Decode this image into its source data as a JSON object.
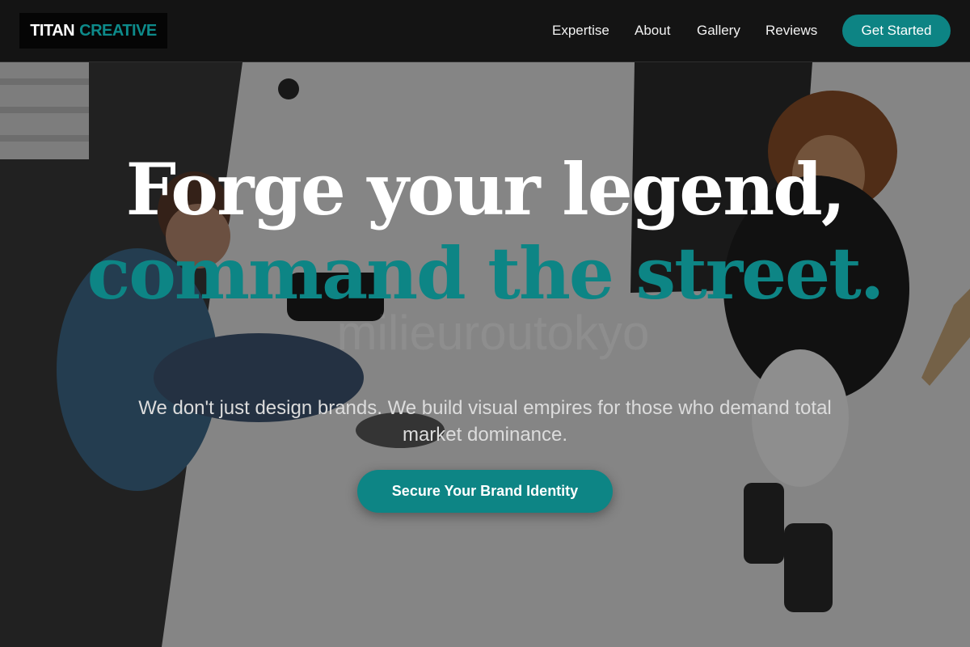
{
  "brand": {
    "word1": "TITAN",
    "word2": "CREATIVE",
    "accent_color": "#0d8a8a"
  },
  "nav": {
    "items": [
      {
        "label": "Expertise"
      },
      {
        "label": "About"
      },
      {
        "label": "Gallery"
      },
      {
        "label": "Reviews"
      }
    ],
    "cta_label": "Get Started"
  },
  "hero": {
    "headline_line1": "Forge your legend,",
    "headline_line2": "command the street.",
    "watermark": "milieuroutokyo",
    "subtitle": "We don't just design brands. We build visual empires for those who demand total market dominance.",
    "cta_label": "Secure Your Brand Identity",
    "accent_color": "#0d8585"
  }
}
